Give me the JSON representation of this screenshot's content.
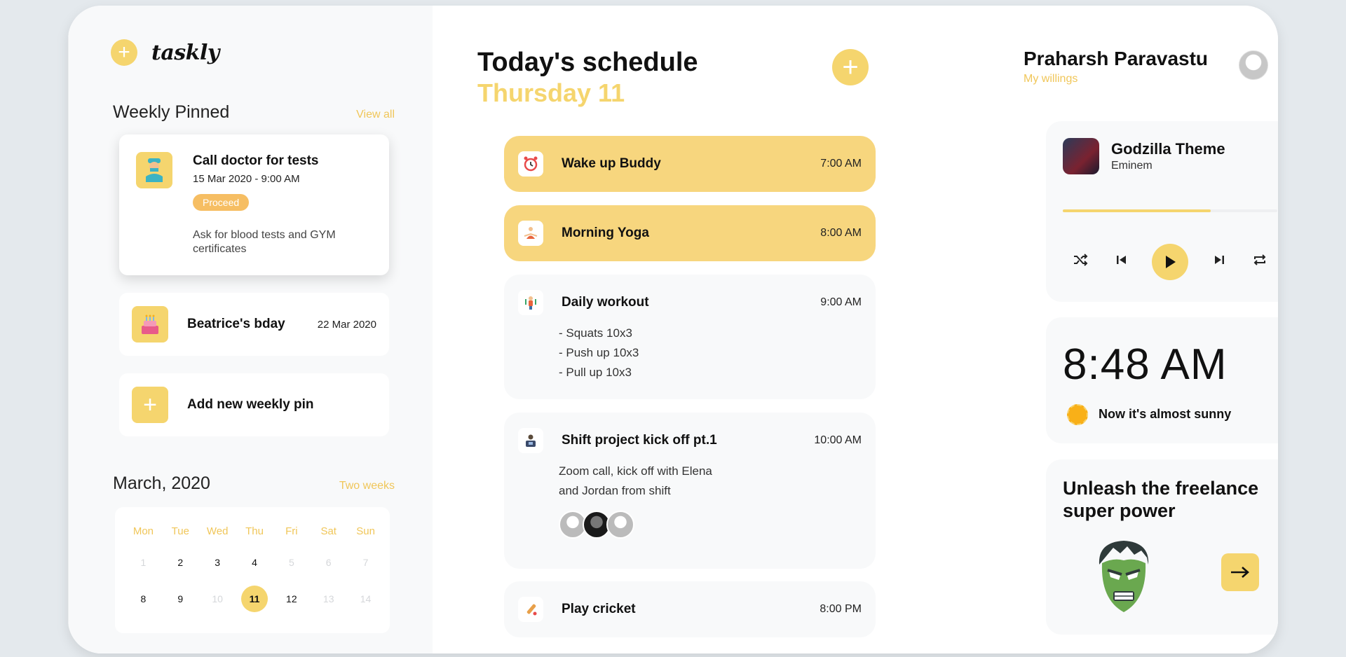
{
  "app": {
    "logo": "taskly"
  },
  "weekly": {
    "title": "Weekly Pinned",
    "view_all": "View all",
    "main_pin": {
      "title": "Call doctor for tests",
      "datetime": "15 Mar 2020 - 9:00 AM",
      "badge": "Proceed",
      "description": "Ask for blood tests and GYM certificates",
      "icon": "doctor-icon"
    },
    "bday_pin": {
      "title": "Beatrice's bday",
      "date": "22 Mar 2020",
      "icon": "cake-icon"
    },
    "add_pin": {
      "label": "Add new weekly pin"
    }
  },
  "calendar": {
    "title": "March, 2020",
    "link": "Two weeks",
    "weekdays": [
      "Mon",
      "Tue",
      "Wed",
      "Thu",
      "Fri",
      "Sat",
      "Sun"
    ],
    "week1": [
      "1",
      "2",
      "3",
      "4",
      "5",
      "6",
      "7"
    ],
    "week2": [
      "8",
      "9",
      "10",
      "11",
      "12",
      "13",
      "14"
    ],
    "selected": "11"
  },
  "schedule": {
    "title": "Today's schedule",
    "day": "Thursday 11",
    "tasks": [
      {
        "name": "Wake up Buddy",
        "time": "7:00 AM",
        "done": true,
        "icon": "alarm-clock-icon"
      },
      {
        "name": "Morning Yoga",
        "time": "8:00 AM",
        "done": true,
        "icon": "yoga-icon"
      },
      {
        "name": "Daily workout",
        "time": "9:00 AM",
        "done": false,
        "icon": "workout-icon",
        "lines": [
          "- Squats 10x3",
          "- Push up 10x3",
          "- Pull up 10x3"
        ]
      },
      {
        "name": "Shift project kick off pt.1",
        "time": "10:00 AM",
        "done": false,
        "icon": "laptop-worker-icon",
        "lines": [
          "Zoom call, kick off with Elena",
          "and Jordan from shift"
        ]
      },
      {
        "name": "Play cricket",
        "time": "8:00 PM",
        "done": false,
        "icon": "cricket-bat-icon"
      }
    ]
  },
  "user": {
    "name": "Praharsh Paravastu",
    "subtitle": "My willings"
  },
  "music": {
    "title": "Godzilla Theme",
    "artist": "Eminem",
    "progress": 0.69
  },
  "clock": {
    "time": "8:48 AM",
    "weather": "Now it's almost sunny"
  },
  "promo": {
    "title": "Unleash the freelance super power"
  },
  "colors": {
    "accent": "#f5d56e",
    "accent_text": "#f0c659",
    "badge": "#f6be63",
    "done_check": "#b8e8bc"
  }
}
